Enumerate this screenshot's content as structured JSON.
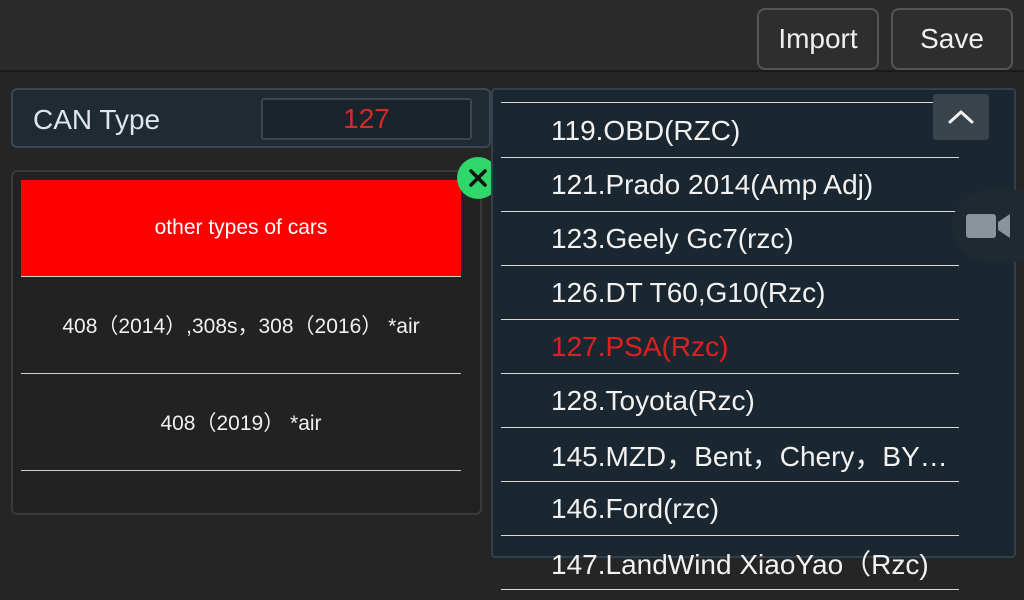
{
  "toolbar": {
    "import_label": "Import",
    "save_label": "Save"
  },
  "can": {
    "label": "CAN Type",
    "value": "127"
  },
  "subtypes": [
    {
      "label": "other types of cars",
      "selected": true
    },
    {
      "label": "408（2014）,308s，308（2016） *air",
      "selected": false
    },
    {
      "label": "408（2019） *air",
      "selected": false
    }
  ],
  "can_list": [
    {
      "label": "119.OBD(RZC)"
    },
    {
      "label": "121.Prado 2014(Amp Adj)"
    },
    {
      "label": "123.Geely Gc7(rzc)"
    },
    {
      "label": "126.DT T60,G10(Rzc)"
    },
    {
      "label": "127.PSA(Rzc)"
    },
    {
      "label": "128.Toyota(Rzc)"
    },
    {
      "label": "145.MZD，Bent，Chery，BY…"
    },
    {
      "label": "146.Ford(rzc)"
    },
    {
      "label": "147.LandWind XiaoYao（Rzc)"
    }
  ],
  "colors": {
    "accent_red": "#e02020",
    "selected_bg": "#ff0000",
    "close_green": "#2fd66a"
  },
  "icons": {
    "close": "close-icon",
    "scroll_up": "chevron-up-icon",
    "camera": "video-camera-icon"
  }
}
